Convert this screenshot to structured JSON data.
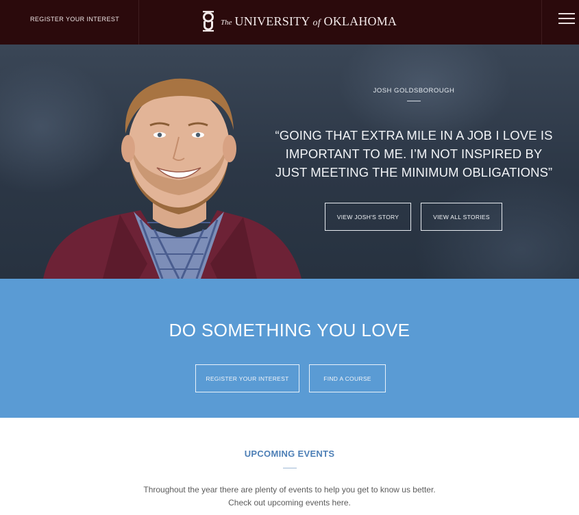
{
  "header": {
    "register_label": "REGISTER YOUR INTEREST",
    "brand_the": "The",
    "brand_name_pre": "UNIVERSITY",
    "brand_of": "of",
    "brand_name_post": "OKLAHOMA",
    "logo_icon": "ou-monogram-logo",
    "menu_icon": "hamburger-menu-icon",
    "background_color": "#2b0a0c"
  },
  "hero": {
    "person_name": "JOSH GOLDSBOROUGH",
    "quote": "“GOING THAT EXTRA MILE IN A JOB I LOVE IS IMPORTANT TO ME. I’M NOT INSPIRED BY JUST MEETING THE MINIMUM OBLIGATIONS”",
    "buttons": {
      "view_story": "VIEW JOSH'S STORY",
      "view_all": "VIEW ALL STORIES"
    }
  },
  "band": {
    "headline": "DO SOMETHING YOU LOVE",
    "buttons": {
      "register": "REGISTER YOUR INTEREST",
      "find_course": "FIND A COURSE"
    },
    "background_color": "#5a9bd4"
  },
  "events": {
    "title": "UPCOMING EVENTS",
    "intro_line1": "Throughout the year there are plenty of events to help you get to know us better.",
    "intro_line2": "Check out upcoming events here."
  }
}
